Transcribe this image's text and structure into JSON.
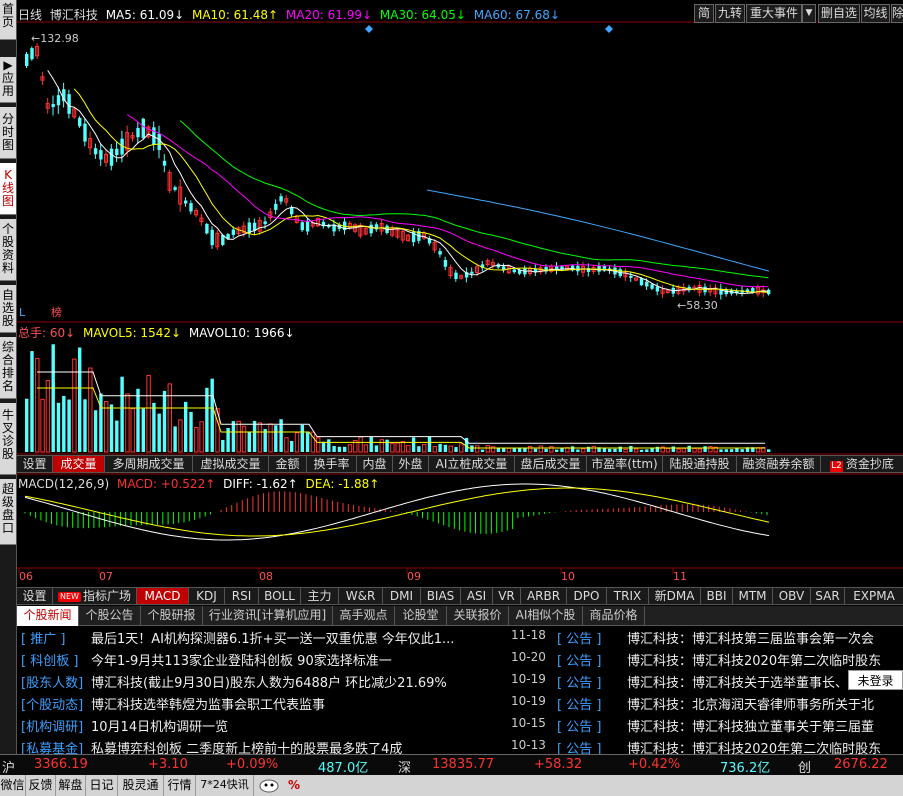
{
  "left_tabs": [
    {
      "label": "首页",
      "active": false
    },
    {
      "label": "▶应用",
      "active": false
    },
    {
      "label": "分时图",
      "active": false
    },
    {
      "label": "K线图",
      "active": true
    },
    {
      "label": "个股资料",
      "active": false
    },
    {
      "label": "自选股",
      "active": false
    },
    {
      "label": "综合排名",
      "active": false
    },
    {
      "label": "牛叉诊股",
      "active": false
    },
    {
      "label": "超级盘口",
      "active": false
    }
  ],
  "header": {
    "period": "日线",
    "stock_name": "博汇科技",
    "ma5": "MA5: 61.09↓",
    "ma10": "MA10: 61.48↑",
    "ma20": "MA20: 61.99↓",
    "ma30": "MA30: 64.05↓",
    "ma60": "MA60: 67.68↓",
    "btn_jian": "简",
    "btn_jiuzhuan": "九转",
    "btn_events": "重大事件",
    "btn_dropdown": "▼",
    "btn_delete_watch": "删自选",
    "btn_equalline": "均线",
    "btn_remove": "除"
  },
  "kline": {
    "high_label": "←132.98",
    "low_label": "←58.30",
    "bottom_l": "L",
    "bottom_bang": "榜"
  },
  "volume": {
    "label_total": "总手: 60↓",
    "label_mavol5": "MAVOL5: 1542↓",
    "label_mavol10": "MAVOL10: 1966↓"
  },
  "indicator_tabs_1": [
    "设置",
    "成交量",
    "多周期成交量",
    "虚拟成交量",
    "金额",
    "换手率",
    "内盘",
    "外盘",
    "AI立桩成交量",
    "盘后成交量",
    "市盈率(ttm)",
    "陆股通持股",
    "融资融券余额",
    "资金抄底"
  ],
  "indicator_tabs_1_active": 1,
  "macd": {
    "label_title": "MACD(12,26,9)",
    "label_macd": "MACD: +0.522↑",
    "label_diff": "DIFF: -1.62↑",
    "label_dea": "DEA: -1.88↑"
  },
  "month_labels": [
    "06",
    "07",
    "08",
    "09",
    "10",
    "11"
  ],
  "indicator_tabs_2": [
    "设置",
    "指标广场",
    "MACD",
    "KDJ",
    "RSI",
    "BOLL",
    "主力",
    "W&R",
    "DMI",
    "BIAS",
    "ASI",
    "VR",
    "ARBR",
    "DPO",
    "TRIX",
    "新DMA",
    "BBI",
    "MTM",
    "OBV",
    "SAR",
    "EXPMA"
  ],
  "indicator_tabs_2_active": 2,
  "new_tag": "NEW",
  "l2_tag": "L2",
  "news_tabs": [
    "个股新闻",
    "个股公告",
    "个股研报",
    "行业资讯[计算机应用]",
    "高手观点",
    "论股堂",
    "关联报价",
    "AI相似个股",
    "商品价格"
  ],
  "news_tabs_active": 0,
  "news_rows": [
    {
      "cat": "[ 推广 ]",
      "title": "最后1天！AI机构探测器6.1折+买一送一双重优惠 今年仅此1...",
      "date": "11-18",
      "tag": "[ 公告 ]",
      "title2": "博汇科技：博汇科技第三届监事会第一次会"
    },
    {
      "cat": "[ 科创板 ]",
      "title": "今年1-9月共113家企业登陆科创板 90家选择标准一",
      "date": "10-20",
      "tag": "[ 公告 ]",
      "title2": "博汇科技：博汇科技2020年第二次临时股东"
    },
    {
      "cat": "[股东人数]",
      "title": "博汇科技(截止9月30日)股东人数为6488户 环比减少21.69%",
      "date": "10-19",
      "tag": "[ 公告 ]",
      "title2": "博汇科技：博汇科技关于选举董事长、"
    },
    {
      "cat": "[个股动态]",
      "title": "博汇科技选举韩煜为监事会职工代表监事",
      "date": "10-19",
      "tag": "[ 公告 ]",
      "title2": "博汇科技：北京海润天睿律师事务所关于北"
    },
    {
      "cat": "[机构调研]",
      "title": "10月14日机构调研一览",
      "date": "10-15",
      "tag": "[ 公告 ]",
      "title2": "博汇科技：博汇科技独立董事关于第三届董"
    },
    {
      "cat": "[私募基金]",
      "title": "私募博弈科创板 二季度新上榜前十的股票最多跌了4成",
      "date": "10-13",
      "tag": "[ 公告 ]",
      "title2": "博汇科技：博汇科技2020年第二次临时股东"
    }
  ],
  "login_tip": "未登录",
  "status_bar": {
    "sh_label": "沪",
    "sh_value": "3366.19",
    "sh_change": "+3.10",
    "sh_pct": "+0.09%",
    "sh_amount": "487.0亿",
    "sz_label": "深",
    "sz_value": "13835.77",
    "sz_change": "+58.32",
    "sz_pct": "+0.42%",
    "sz_amount": "736.2亿",
    "cy_label": "创",
    "cy_value": "2676.22"
  },
  "bottom_bar": [
    "微信",
    "反馈",
    "解盘",
    "日记",
    "股灵通",
    "行情",
    "7*24快讯",
    "%"
  ],
  "colors": {
    "up": "#ff3232",
    "down": "#54ffff",
    "ma5": "#ffffff",
    "ma10": "#ffff00",
    "ma20": "#ff00ff",
    "ma30": "#00ff00",
    "ma60": "#3fa8ff"
  }
}
